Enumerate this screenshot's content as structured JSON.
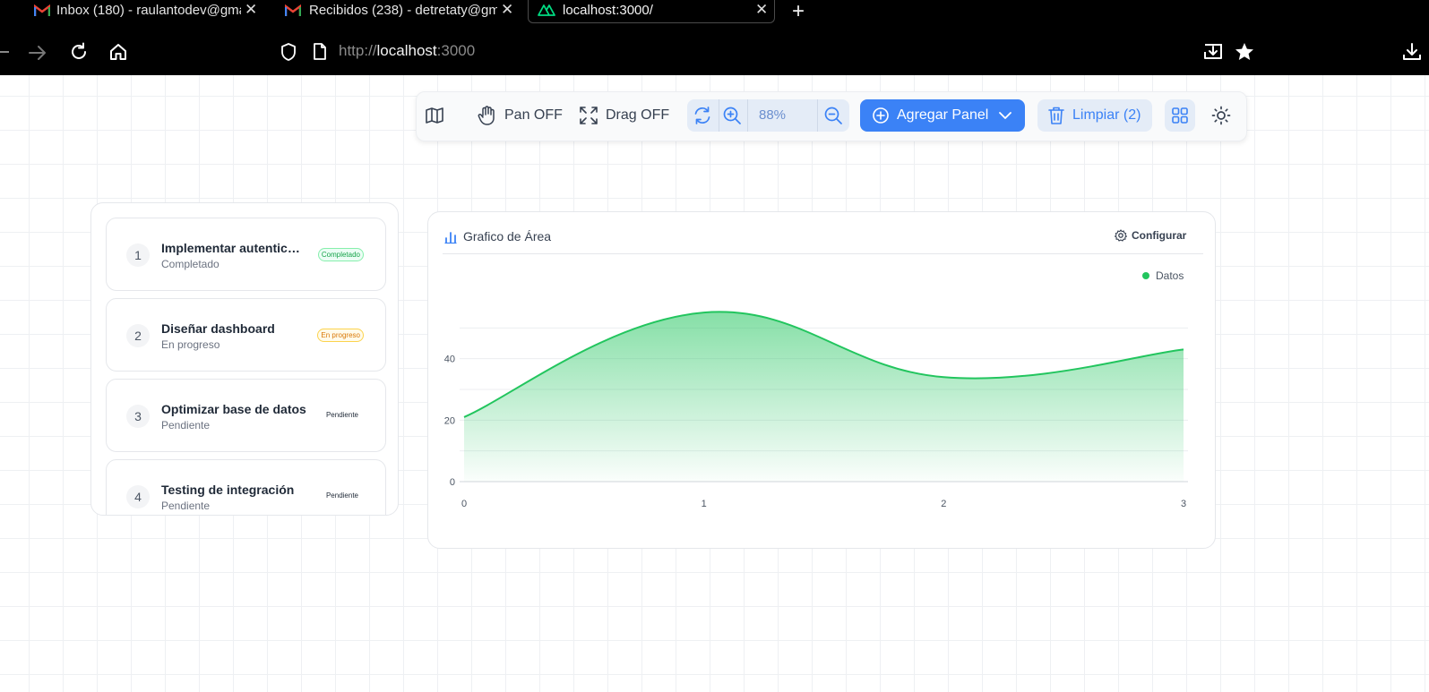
{
  "browser": {
    "tabs": [
      {
        "title": "Inbox (180) - raulantodev@gma",
        "icon": "gmail-icon",
        "active": false
      },
      {
        "title": "Recibidos (238) - detretaty@gm",
        "icon": "gmail-icon",
        "active": false
      },
      {
        "title": "localhost:3000/",
        "icon": "nuxt-icon",
        "active": true
      }
    ],
    "close_glyph": "✕",
    "new_tab_glyph": "+",
    "url_scheme": "http://",
    "url_host": "localhost",
    "url_port": ":3000"
  },
  "toolbar": {
    "pan_label": "Pan OFF",
    "drag_label": "Drag OFF",
    "zoom_value": "88%",
    "add_panel_label": "Agregar Panel",
    "clear_label": "Limpiar (2)"
  },
  "tasks": [
    {
      "num": "1",
      "title": "Implementar autentica...",
      "status": "Completado",
      "badge": "Completado",
      "badge_type": "done"
    },
    {
      "num": "2",
      "title": "Diseñar dashboard",
      "status": "En progreso",
      "badge": "En progreso",
      "badge_type": "progress"
    },
    {
      "num": "3",
      "title": "Optimizar base de datos",
      "status": "Pendiente",
      "badge": "Pendiente",
      "badge_type": "pending"
    },
    {
      "num": "4",
      "title": "Testing de integración",
      "status": "Pendiente",
      "badge": "Pendiente",
      "badge_type": "pending"
    }
  ],
  "chart_panel": {
    "title": "Grafico de Área",
    "config_label": "Configurar"
  },
  "colors": {
    "accent": "#3b82f6",
    "series": "#22c55e"
  },
  "chart_data": {
    "type": "area",
    "x": [
      0,
      1,
      2,
      3
    ],
    "series": [
      {
        "name": "Datos",
        "values": [
          21,
          55,
          34,
          43
        ]
      }
    ],
    "ylim": [
      0,
      60
    ],
    "yticks": [
      0,
      20,
      40
    ],
    "xlim": [
      0,
      3
    ],
    "grid": true,
    "legend": "top-right",
    "xlabel": "",
    "ylabel": ""
  }
}
